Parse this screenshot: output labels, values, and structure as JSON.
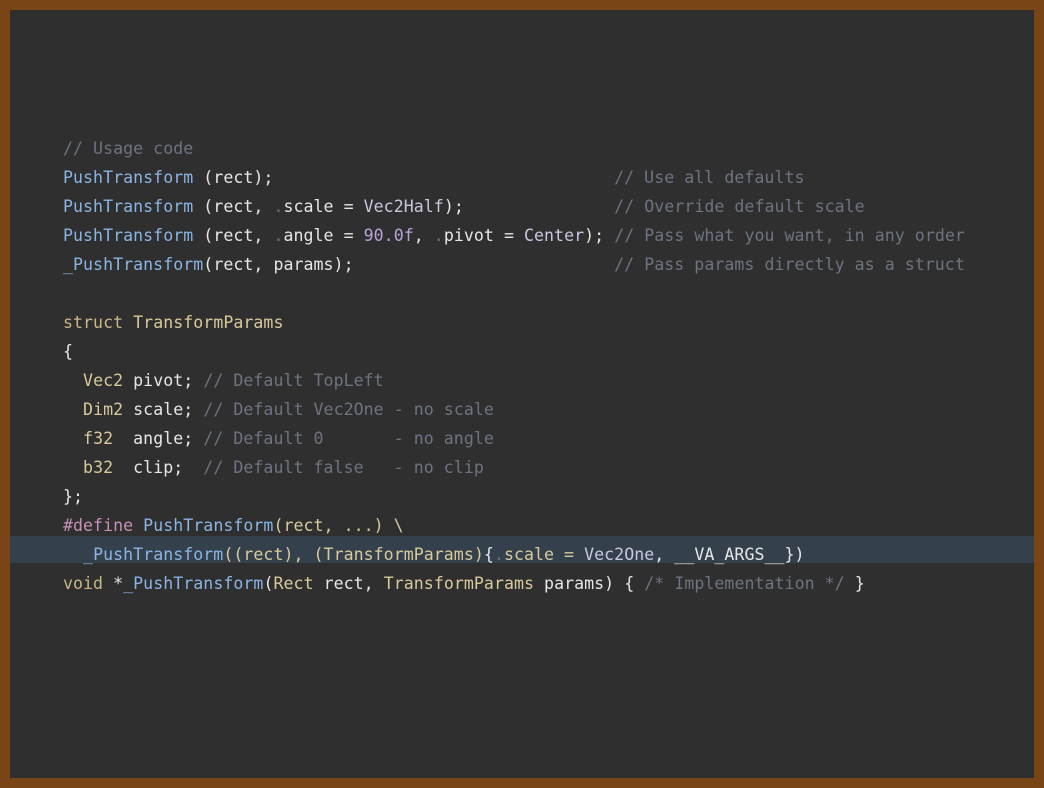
{
  "code_lines": [
    [
      {
        "t": "// Usage code",
        "c": "c"
      }
    ],
    [
      {
        "t": "PushTransform",
        "c": "f"
      },
      {
        "t": " (rect);                                  ",
        "c": "n"
      },
      {
        "t": "// Use all defaults",
        "c": "c"
      }
    ],
    [
      {
        "t": "PushTransform",
        "c": "f"
      },
      {
        "t": " (rect, ",
        "c": "n"
      },
      {
        "t": ".",
        "c": "c"
      },
      {
        "t": "scale = ",
        "c": "n"
      },
      {
        "t": "Vec2Half",
        "c": "v"
      },
      {
        "t": ");               ",
        "c": "n"
      },
      {
        "t": "// Override default scale",
        "c": "c"
      }
    ],
    [
      {
        "t": "PushTransform",
        "c": "f"
      },
      {
        "t": " (rect, ",
        "c": "n"
      },
      {
        "t": ".",
        "c": "c"
      },
      {
        "t": "angle = ",
        "c": "n"
      },
      {
        "t": "90.0f",
        "c": "m"
      },
      {
        "t": ", ",
        "c": "n"
      },
      {
        "t": ".",
        "c": "c"
      },
      {
        "t": "pivot = ",
        "c": "n"
      },
      {
        "t": "Center",
        "c": "v"
      },
      {
        "t": "); ",
        "c": "n"
      },
      {
        "t": "// Pass what you want, in any order",
        "c": "c"
      }
    ],
    [
      {
        "t": "_PushTransform",
        "c": "f"
      },
      {
        "t": "(rect, params);                          ",
        "c": "n"
      },
      {
        "t": "// Pass params directly as a struct",
        "c": "c"
      }
    ],
    [
      {
        "t": " ",
        "c": "n"
      }
    ],
    [
      {
        "t": "struct ",
        "c": "k"
      },
      {
        "t": "TransformParams",
        "c": "t"
      }
    ],
    [
      {
        "t": "{",
        "c": "n"
      }
    ],
    [
      {
        "t": "  ",
        "c": "n"
      },
      {
        "t": "Vec2",
        "c": "t"
      },
      {
        "t": " pivot; ",
        "c": "n"
      },
      {
        "t": "// Default TopLeft",
        "c": "c"
      }
    ],
    [
      {
        "t": "  ",
        "c": "n"
      },
      {
        "t": "Dim2",
        "c": "t"
      },
      {
        "t": " scale; ",
        "c": "n"
      },
      {
        "t": "// Default Vec2One - no scale",
        "c": "c"
      }
    ],
    [
      {
        "t": "  ",
        "c": "n"
      },
      {
        "t": "f32",
        "c": "t"
      },
      {
        "t": "  angle; ",
        "c": "n"
      },
      {
        "t": "// Default 0       - no angle",
        "c": "c"
      }
    ],
    [
      {
        "t": "  ",
        "c": "n"
      },
      {
        "t": "b32",
        "c": "t"
      },
      {
        "t": "  clip;  ",
        "c": "n"
      },
      {
        "t": "// Default false   - no clip",
        "c": "c"
      }
    ],
    [
      {
        "t": "};",
        "c": "n"
      }
    ],
    [
      {
        "t": "#define ",
        "c": "d"
      },
      {
        "t": "PushTransform",
        "c": "f"
      },
      {
        "t": "(rect, ...) \\",
        "c": "t"
      }
    ],
    [
      {
        "t": "  ",
        "c": "n"
      },
      {
        "t": "_PushTransform",
        "c": "f"
      },
      {
        "t": "((rect), (TransformParams)",
        "c": "t"
      },
      {
        "t": "{",
        "c": "n"
      },
      {
        "t": ".",
        "c": "c"
      },
      {
        "t": "scale = ",
        "c": "t"
      },
      {
        "t": "Vec2One",
        "c": "v"
      },
      {
        "t": ", __VA_ARGS__})",
        "c": "n"
      }
    ],
    [
      {
        "t": "void ",
        "c": "k"
      },
      {
        "t": "*",
        "c": "n"
      },
      {
        "t": "_PushTransform",
        "c": "f"
      },
      {
        "t": "(",
        "c": "n"
      },
      {
        "t": "Rect",
        "c": "t"
      },
      {
        "t": " rect, ",
        "c": "n"
      },
      {
        "t": "TransformParams",
        "c": "t"
      },
      {
        "t": " params) { ",
        "c": "n"
      },
      {
        "t": "/* Implementation */",
        "c": "c"
      },
      {
        "t": " }",
        "c": "n"
      }
    ]
  ],
  "highlighted_line": 14
}
